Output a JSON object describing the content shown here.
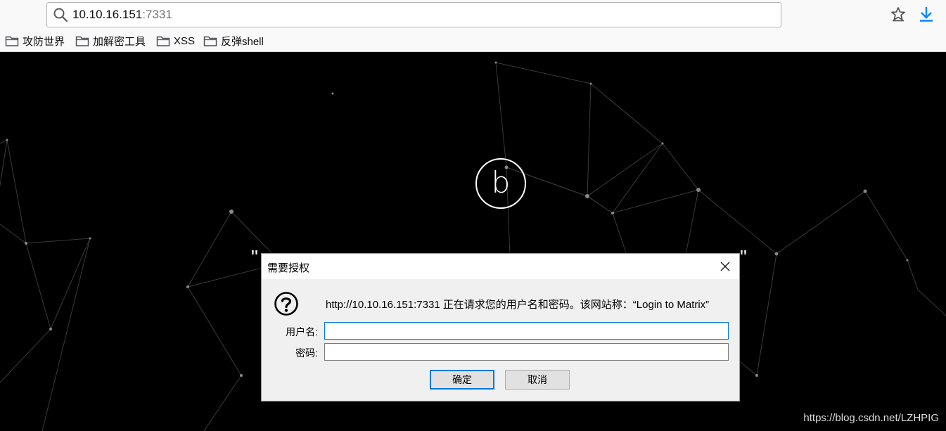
{
  "browser": {
    "url_host": "10.10.16.151",
    "url_port": ":7331",
    "icons": {
      "search": "search-icon",
      "bookmark": "bookmark-star-icon",
      "download": "download-icon"
    },
    "bookmarks": [
      {
        "label": "攻防世界",
        "icon": "folder-icon"
      },
      {
        "label": "加解密工具",
        "icon": "folder-icon"
      },
      {
        "label": "XSS",
        "icon": "folder-icon"
      },
      {
        "label": "反弹shell",
        "icon": "folder-icon"
      }
    ],
    "accent_color": "#0a84ff"
  },
  "page": {
    "logo_letter": "b",
    "quote_left": "\"",
    "quote_right": "\"",
    "watermark": "https://blog.csdn.net/LZHPIG",
    "background_color": "#000000"
  },
  "dialog": {
    "title": "需要授权",
    "message": "http://10.10.16.151:7331 正在请求您的用户名和密码。该网站称：“Login to Matrix”",
    "username_label": "用户名:",
    "username_value": "",
    "password_label": "密码:",
    "password_value": "",
    "ok_label": "确定",
    "cancel_label": "取消",
    "icons": {
      "close": "close-icon",
      "question": "question-icon"
    },
    "focus_color": "#0078d7"
  }
}
